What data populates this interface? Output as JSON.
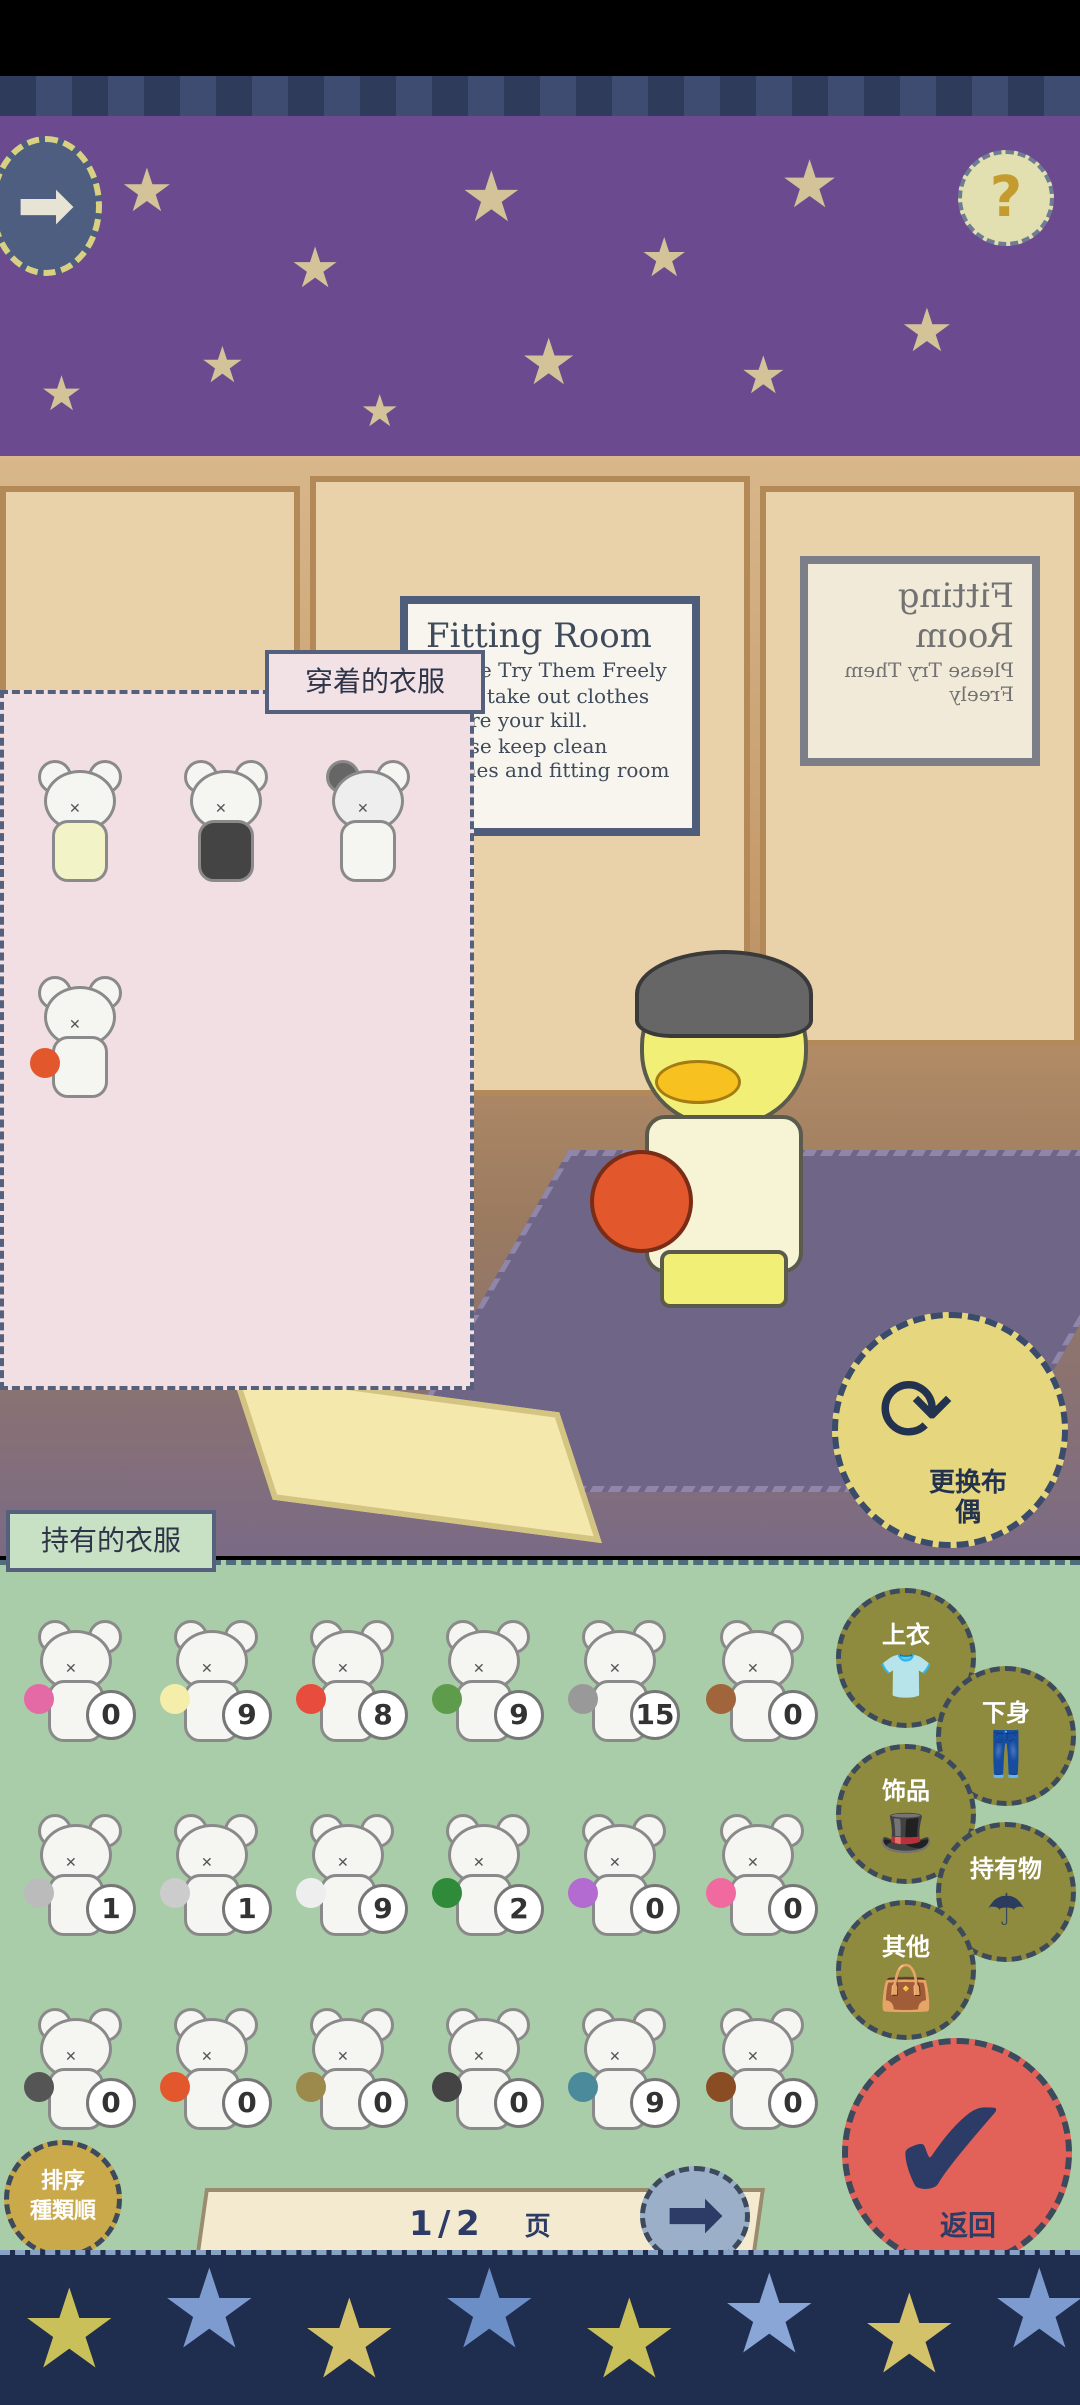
{
  "header": {
    "help_symbol": "?",
    "menu_arrow": "➡"
  },
  "room_signs": [
    {
      "title": "Fitting Room",
      "lines": [
        "Please Try Them Freely",
        "Don't take out clothes before your kill.",
        "Please keep clean clothes and fitting room"
      ]
    }
  ],
  "worn_panel": {
    "title": "穿着的衣服",
    "items": [
      {
        "name": "overalls"
      },
      {
        "name": "black-jacket"
      },
      {
        "name": "turban-hat"
      },
      {
        "name": "basketball"
      }
    ]
  },
  "change_doll": {
    "label": "更换布偶"
  },
  "owned_panel": {
    "title": "持有的衣服",
    "items": [
      {
        "icon": "party-popper",
        "count": "0"
      },
      {
        "icon": "yellow-umbrella",
        "count": "9"
      },
      {
        "icon": "rainbow-umbrella",
        "count": "8"
      },
      {
        "icon": "leaf-umbrella",
        "count": "9"
      },
      {
        "icon": "sword",
        "count": "15"
      },
      {
        "icon": "guitar",
        "count": "0"
      },
      {
        "icon": "silver-tray",
        "count": "1"
      },
      {
        "icon": "cloche-tray",
        "count": "1"
      },
      {
        "icon": "bare-hand",
        "count": "9"
      },
      {
        "icon": "green-flag",
        "count": "2"
      },
      {
        "icon": "ice-cream",
        "count": "0"
      },
      {
        "icon": "pink-balloon",
        "count": "0"
      },
      {
        "icon": "pen",
        "count": "0"
      },
      {
        "icon": "basketball",
        "count": "0"
      },
      {
        "icon": "cane",
        "count": "0"
      },
      {
        "icon": "microphone",
        "count": "0"
      },
      {
        "icon": "fishing-rod",
        "count": "9"
      },
      {
        "icon": "violin",
        "count": "0"
      }
    ]
  },
  "categories": [
    {
      "label": "上衣",
      "icon": "shirt-icon"
    },
    {
      "label": "下身",
      "icon": "pants-icon"
    },
    {
      "label": "饰品",
      "icon": "hat-bow-icon"
    },
    {
      "label": "持有物",
      "icon": "umbrella-icon"
    },
    {
      "label": "其他",
      "icon": "bag-icon"
    }
  ],
  "return_button": {
    "label": "返回"
  },
  "sort_button": {
    "line1": "排序",
    "line2": "種類順"
  },
  "pager": {
    "current": "1",
    "separator": "/",
    "total": "2",
    "unit": "页"
  },
  "colors": {
    "ceiling": "#6c4a90",
    "worn_panel": "#f1dfe4",
    "owned_panel": "#a9cda8",
    "accent_navy": "#2c3c66",
    "return_red": "#e2625a"
  }
}
